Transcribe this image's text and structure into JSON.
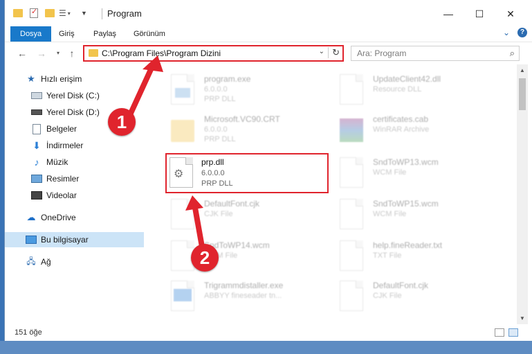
{
  "window": {
    "title": "Program",
    "minimize_label": "—",
    "maximize_label": "☐",
    "close_label": "✕"
  },
  "ribbon": {
    "tabs": [
      "Dosya",
      "Giriş",
      "Paylaş",
      "Görünüm"
    ],
    "help_label": "?"
  },
  "address": {
    "path": "C:\\Program Files\\Program Dizini",
    "search_placeholder": "Ara: Program"
  },
  "sidebar": {
    "items": [
      {
        "label": "Hızlı erişim",
        "icon": "star-icon",
        "pinned": false
      },
      {
        "label": "Yerel Disk (C:)",
        "icon": "drive-icon",
        "pinned": false
      },
      {
        "label": "Yerel Disk (D:)",
        "icon": "drive-icon",
        "pinned": true
      },
      {
        "label": "Belgeler",
        "icon": "documents-icon",
        "pinned": true
      },
      {
        "label": "İndirmeler",
        "icon": "download-icon",
        "pinned": true
      },
      {
        "label": "Müzik",
        "icon": "music-icon",
        "pinned": true
      },
      {
        "label": "Resimler",
        "icon": "pictures-icon",
        "pinned": true
      },
      {
        "label": "Videolar",
        "icon": "video-icon",
        "pinned": true
      },
      {
        "label": "OneDrive",
        "icon": "cloud-icon",
        "pinned": false
      },
      {
        "label": "Bu bilgisayar",
        "icon": "computer-icon",
        "pinned": false
      },
      {
        "label": "Ağ",
        "icon": "network-icon",
        "pinned": false
      }
    ]
  },
  "files": {
    "left": [
      {
        "name": "program.exe",
        "line2": "6.0.0.0",
        "line3": "PRP DLL"
      },
      {
        "name": "Microsoft.VC90.CRT",
        "line2": "6.0.0.0",
        "line3": "PRP DLL"
      },
      {
        "name": "prp.dll",
        "line2": "6.0.0.0",
        "line3": "PRP DLL"
      },
      {
        "name": "DefaultFont.cjk",
        "line2": "CJK File",
        "line3": ""
      },
      {
        "name": "SndToWP14.wcm",
        "line2": "WCM File",
        "line3": ""
      },
      {
        "name": "Trigrammdistaller.exe",
        "line2": "ABBYY fineseader tn...",
        "line3": ""
      }
    ],
    "right": [
      {
        "name": "UpdateClient42.dll",
        "line2": "Resource DLL",
        "line3": ""
      },
      {
        "name": "certificates.cab",
        "line2": "WinRAR Archive",
        "line3": ""
      },
      {
        "name": "SndToWP13.wcm",
        "line2": "WCM File",
        "line3": ""
      },
      {
        "name": "SndToWP15.wcm",
        "line2": "WCM File",
        "line3": ""
      },
      {
        "name": "help.fineReader.txt",
        "line2": "TXT File",
        "line3": ""
      },
      {
        "name": "DefaultFont.cjk",
        "line2": "CJK File",
        "line3": ""
      }
    ]
  },
  "status": {
    "count": "151 öğe"
  },
  "callouts": [
    "1",
    "2"
  ],
  "colors": {
    "accent": "#1979ca",
    "highlight": "#e0242d",
    "selection": "#cce4f7"
  }
}
